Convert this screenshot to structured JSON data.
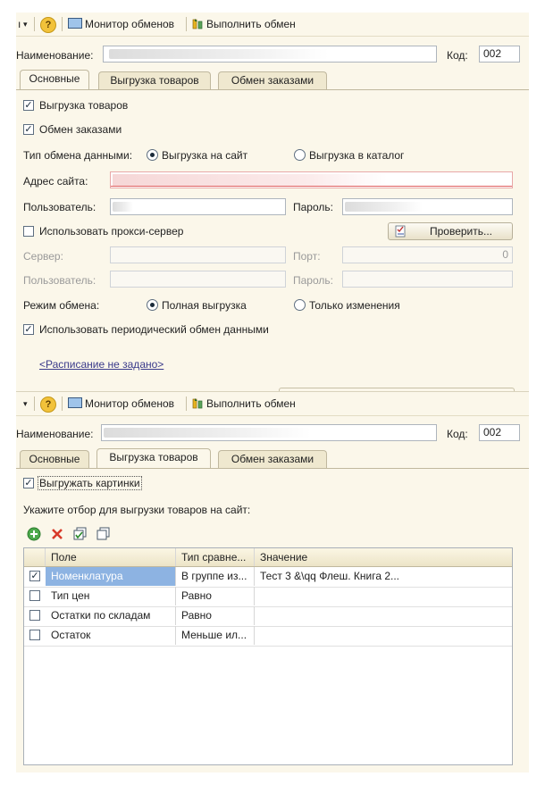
{
  "toolbar": {
    "left_char": "ı",
    "dropdown_glyph": "▾",
    "help_glyph": "?",
    "monitor_label": "Монитор обменов",
    "execute_label": "Выполнить обмен"
  },
  "header": {
    "name_label": "Наименование:",
    "code_label": "Код:",
    "code_value": "002"
  },
  "tabs": [
    {
      "label": "Основные"
    },
    {
      "label": "Выгрузка товаров"
    },
    {
      "label": "Обмен заказами"
    }
  ],
  "basic": {
    "export_goods_label": "Выгрузка товаров",
    "exchange_orders_label": "Обмен заказами",
    "exchange_type_label": "Тип обмена данными:",
    "radio_site_label": "Выгрузка на сайт",
    "radio_catalog_label": "Выгрузка в каталог",
    "site_address_label": "Адрес сайта:",
    "user_label": "Пользователь:",
    "password_label": "Пароль:",
    "proxy_label": "Использовать прокси-сервер",
    "check_button_label": "Проверить...",
    "server_label": "Сервер:",
    "port_label": "Порт:",
    "port_value": "0",
    "proxy_user_label": "Пользователь:",
    "proxy_password_label": "Пароль:",
    "mode_label": "Режим обмена:",
    "radio_full_label": "Полная выгрузка",
    "radio_changes_label": "Только изменения",
    "periodic_label": "Использовать периодический обмен данными",
    "schedule_link": "<Расписание не задано>"
  },
  "goods": {
    "export_images_label": "Выгружать картинки",
    "filter_caption": "Укажите отбор для выгрузки товаров на сайт:",
    "columns": [
      "Поле",
      "Тип сравне...",
      "Значение"
    ],
    "rows": [
      {
        "checked": true,
        "field": "Номенклатура",
        "compare": "В группе из...",
        "value": "Тест 3 &\\qq Флеш. Книга 2..."
      },
      {
        "checked": false,
        "field": "Тип цен",
        "compare": "Равно",
        "value": ""
      },
      {
        "checked": false,
        "field": "Остатки по складам",
        "compare": "Равно",
        "value": ""
      },
      {
        "checked": false,
        "field": "Остаток",
        "compare": "Меньше ил...",
        "value": ""
      }
    ]
  },
  "colors": {
    "panel_bg": "#fbf7ea",
    "selection": "#8db3e2",
    "link": "#3a3a8a"
  }
}
